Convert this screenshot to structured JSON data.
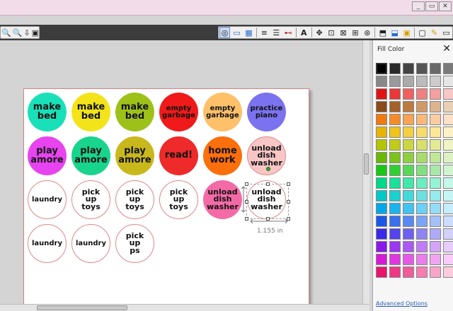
{
  "window": {
    "buttons": [
      "_",
      "▭",
      "✕"
    ]
  },
  "toolbar": {
    "left_group": [
      "🔍",
      "🔍",
      "⇩",
      "▣"
    ],
    "right_group": [
      "◎",
      "▭",
      "▦",
      "≡",
      "☰",
      "⊷",
      "A",
      "✥",
      "⊡",
      "⊠",
      "⊞",
      "⊛",
      "⬒",
      "⬓",
      "▣",
      "▢",
      "✎",
      "▭"
    ]
  },
  "circles": [
    {
      "text": "make\nbed",
      "color": "#19e0b8",
      "outline": false
    },
    {
      "text": "make\nbed",
      "color": "#f3e41a",
      "outline": false
    },
    {
      "text": "make\nbed",
      "color": "#9ec11a",
      "outline": false
    },
    {
      "text": "empty\ngarbage",
      "color": "#f01a1a",
      "outline": false
    },
    {
      "text": "empty\ngarbage",
      "color": "#ffc06a",
      "outline": false
    },
    {
      "text": "practice\npiano",
      "color": "#7b72ef",
      "outline": false
    },
    {
      "text": "play\namore",
      "color": "#e744f0",
      "outline": false
    },
    {
      "text": "play\namore",
      "color": "#19d48c",
      "outline": false
    },
    {
      "text": "play\namore",
      "color": "#c9b81c",
      "outline": false
    },
    {
      "text": "read!",
      "color": "#ee2a2a",
      "outline": false
    },
    {
      "text": "home\nwork",
      "color": "#fb6f0c",
      "outline": false
    },
    {
      "text": "unload\ndish\nwasher",
      "color": "#f9c6c6",
      "outline": true
    },
    {
      "text": "laundry",
      "color": "#ffffff",
      "outline": true
    },
    {
      "text": "pick\nup\ntoys",
      "color": "#ffffff",
      "outline": true
    },
    {
      "text": "pick\nup\ntoys",
      "color": "#ffffff",
      "outline": true
    },
    {
      "text": "pick\nup\ntoys",
      "color": "#ffffff",
      "outline": true
    },
    {
      "text": "unload\ndish\nwasher",
      "color": "#f46aa7",
      "outline": false
    },
    {
      "text": "unload\ndish\nwasher",
      "color": "#ffffff",
      "outline": true
    },
    {
      "text": "laundry",
      "color": "#ffffff",
      "outline": true
    },
    {
      "text": "laundry",
      "color": "#ffffff",
      "outline": true
    },
    {
      "text": "pick\nup\nps",
      "color": "#ffffff",
      "outline": true
    }
  ],
  "selection": {
    "width_label": "1.155 in"
  },
  "panel": {
    "title": "Fill Color",
    "close": "✕",
    "advanced_link": "Advanced Options",
    "swatches": [
      "#000000",
      "#2a2a2a",
      "#444444",
      "#555555",
      "#6a6a6a",
      "#7a7a7a",
      "#888888",
      "#9a9a9a",
      "#aaaaaa",
      "#bbbbbb",
      "#cccccc",
      "#e6e6e6",
      "#e11414",
      "#ea3838",
      "#f06060",
      "#f08080",
      "#f4a0a0",
      "#f8c6c6",
      "#8a4b1a",
      "#a4622a",
      "#bc7a40",
      "#d09a68",
      "#dbb48c",
      "#e8d0b4",
      "#f07a10",
      "#f48c2a",
      "#f8a454",
      "#f8b878",
      "#fccca0",
      "#fce0c8",
      "#e8b400",
      "#f0c41a",
      "#f4d040",
      "#f8dc6a",
      "#fae894",
      "#fcf2c4",
      "#b4c400",
      "#c0cc1a",
      "#ccd640",
      "#d8e06a",
      "#e4ea94",
      "#f0f4c4",
      "#6ab800",
      "#7cc41a",
      "#90d040",
      "#a8dc6a",
      "#c0e894",
      "#dcf2c4",
      "#14c814",
      "#30d030",
      "#58d858",
      "#80e080",
      "#a8e8a8",
      "#d0f4d0",
      "#00d88a",
      "#1ae09a",
      "#40e8ac",
      "#6aeec0",
      "#94f4d4",
      "#c4f8e8",
      "#00c8c8",
      "#1ad0d0",
      "#40dada",
      "#6ae2e2",
      "#94ecec",
      "#c4f6f6",
      "#00a8e8",
      "#1ab4ee",
      "#40c4f2",
      "#6ad0f6",
      "#94dcf8",
      "#c4ecfc",
      "#1a58e8",
      "#3870ee",
      "#5888f2",
      "#7ca4f6",
      "#a4c0f8",
      "#ccdcfc",
      "#3a2ae8",
      "#5444ee",
      "#6e60f2",
      "#8e84f6",
      "#b0a8f8",
      "#d4d0fc",
      "#8a1ae8",
      "#9a38ee",
      "#ac58f2",
      "#c07cf6",
      "#d4a4f8",
      "#e8ccfc",
      "#d41ad4",
      "#de38de",
      "#e658e6",
      "#ec7cec",
      "#f2a4f2",
      "#f8ccf8",
      "#e8146e",
      "#ee3884",
      "#f25a9a",
      "#f67cb2",
      "#f8a4c8",
      "#fcccde"
    ]
  }
}
